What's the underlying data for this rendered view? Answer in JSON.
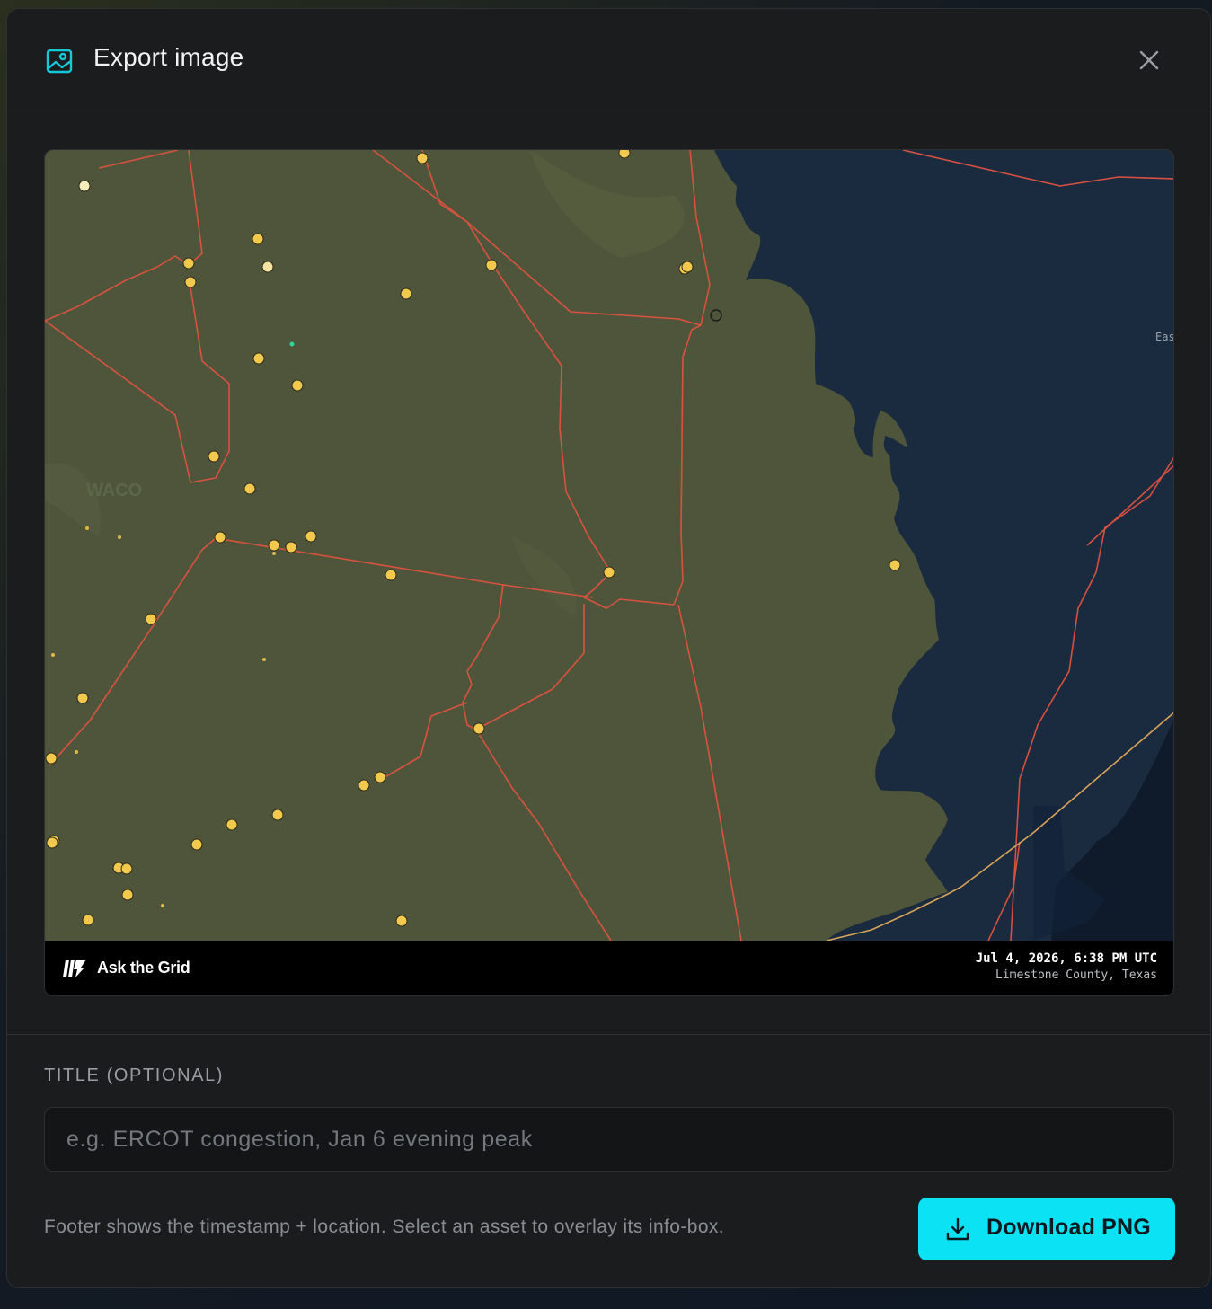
{
  "dialog": {
    "title": "Export image",
    "header_icon": "image-icon",
    "close_icon": "close-icon"
  },
  "preview": {
    "brand": "Ask the Grid",
    "timestamp": "Jul 4, 2026, 6:38 PM UTC",
    "location": "Limestone County, Texas",
    "map_labels": {
      "waco": "WACO",
      "east": "Eas"
    },
    "colors": {
      "land_fill": "#4e553b",
      "water_region": "#1a2a3f",
      "transmission_line": "#e0533f",
      "state_border": "#d9a45a",
      "asset_marker": "#f2c94c"
    }
  },
  "form": {
    "title_label": "TITLE (OPTIONAL)",
    "title_placeholder": "e.g. ERCOT congestion, Jan 6 evening peak",
    "help_text": "Footer shows the timestamp + location. Select an asset to overlay its info-box.",
    "download_label": "Download PNG",
    "download_icon": "download-icon",
    "accent_color": "#0be3f5"
  }
}
